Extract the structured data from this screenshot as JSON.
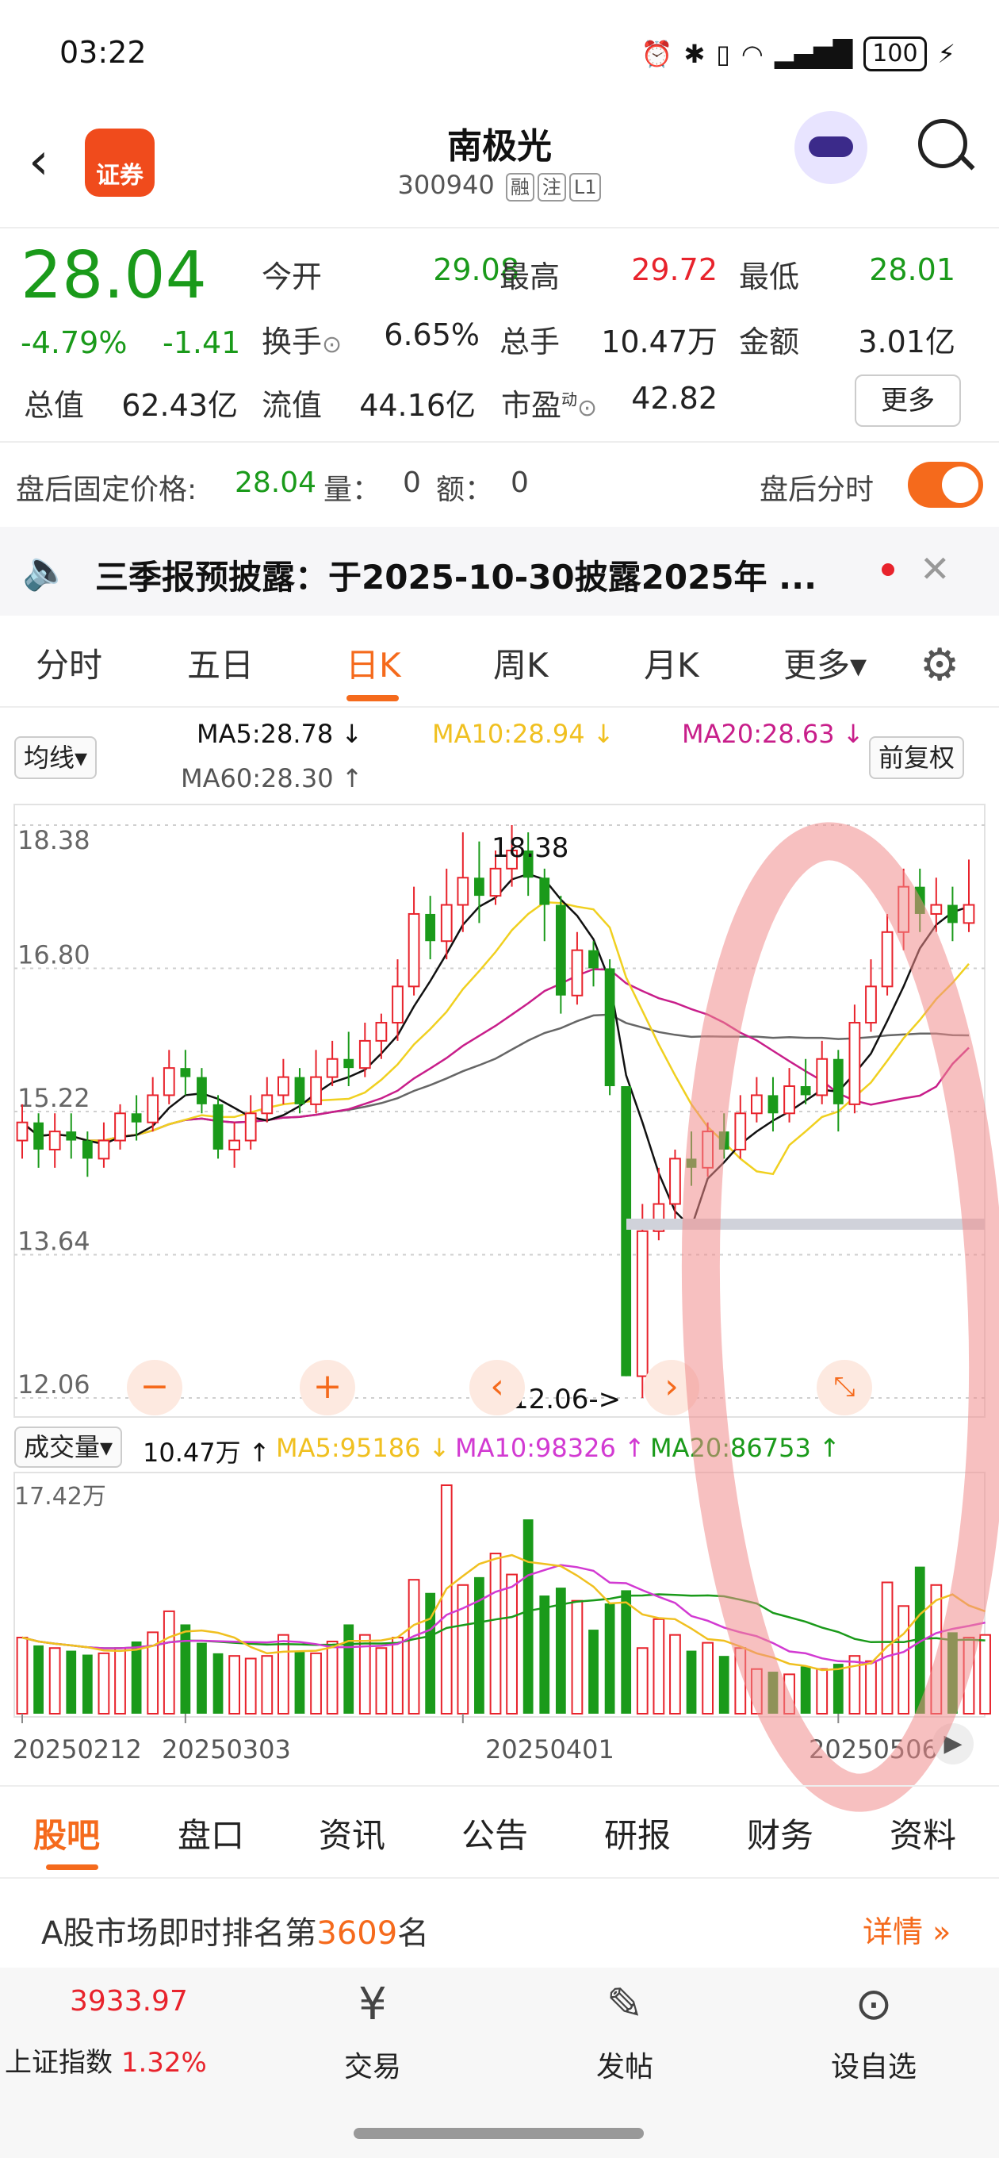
{
  "status_bar": {
    "time": "03:22",
    "battery": "100"
  },
  "header": {
    "stock_name": "南极光",
    "stock_code": "300940",
    "tags": [
      "融",
      "注",
      "L1"
    ],
    "logo_text": "证券"
  },
  "quote": {
    "price": "28.04",
    "change_pct": "-4.79%",
    "change": "-1.41",
    "labels": {
      "open": "今开",
      "high": "最高",
      "low": "最低",
      "turnover": "换手",
      "volume": "总手",
      "amount": "金额",
      "mktcap": "总值",
      "float_cap": "流值",
      "pe": "市盈"
    },
    "values": {
      "open": "29.08",
      "high": "29.72",
      "low": "28.01",
      "turnover": "6.65%",
      "volume": "10.47万",
      "amount": "3.01亿",
      "mktcap": "62.43亿",
      "float_cap": "44.16亿",
      "pe": "42.82"
    },
    "pe_sup": "动",
    "more_button": "更多",
    "colors": {
      "up": "#e8232c",
      "down": "#1a9a1a"
    }
  },
  "after_hours": {
    "label": "盘后固定价格:",
    "price": "28.04",
    "vol_label": "量：",
    "vol": "0",
    "amt_label": "额：",
    "amt": "0",
    "toggle_label": "盘后分时",
    "toggle_on": true
  },
  "notice": {
    "text": "三季报预披露：于2025-10-30披露2025年 ..."
  },
  "chart_tabs": {
    "items": [
      "分时",
      "五日",
      "日K",
      "周K",
      "月K",
      "更多▾"
    ],
    "active": "日K"
  },
  "ma_legend": {
    "selector": "均线▾",
    "ma5": "MA5:28.78 ↓",
    "ma10": "MA10:28.94 ↓",
    "ma20": "MA20:28.63 ↓",
    "ma60": "MA60:28.30 ↑",
    "adjust": "前复权"
  },
  "price_axis": {
    "ticks": [
      "18.38",
      "16.80",
      "15.22",
      "13.64",
      "12.06"
    ],
    "high_marker": "18.38",
    "low_marker": "12.06->"
  },
  "volume_legend": {
    "selector": "成交量▾",
    "vol": "10.47万 ↑",
    "ma5": "MA5:95186 ↓",
    "ma10": "MA10:98326 ↑",
    "ma20": "MA20:86753 ↑",
    "max": "17.42万"
  },
  "date_axis": [
    "20250212",
    "20250303",
    "20250401",
    "20250506"
  ],
  "chart_data": {
    "type": "candlestick",
    "ylim": [
      12.06,
      18.38
    ],
    "volume_max": "17.42万",
    "candles": [
      {
        "o": 14.9,
        "c": 15.1,
        "h": 15.3,
        "l": 14.7
      },
      {
        "o": 15.1,
        "c": 14.8,
        "h": 15.2,
        "l": 14.6
      },
      {
        "o": 14.8,
        "c": 15.0,
        "h": 15.2,
        "l": 14.6
      },
      {
        "o": 15.0,
        "c": 14.9,
        "h": 15.2,
        "l": 14.7
      },
      {
        "o": 14.9,
        "c": 14.7,
        "h": 15.0,
        "l": 14.5
      },
      {
        "o": 14.7,
        "c": 14.9,
        "h": 15.1,
        "l": 14.6
      },
      {
        "o": 14.9,
        "c": 15.2,
        "h": 15.3,
        "l": 14.8
      },
      {
        "o": 15.2,
        "c": 15.1,
        "h": 15.4,
        "l": 14.9
      },
      {
        "o": 15.1,
        "c": 15.4,
        "h": 15.6,
        "l": 15.0
      },
      {
        "o": 15.4,
        "c": 15.7,
        "h": 15.9,
        "l": 15.3
      },
      {
        "o": 15.7,
        "c": 15.6,
        "h": 15.9,
        "l": 15.4
      },
      {
        "o": 15.6,
        "c": 15.3,
        "h": 15.7,
        "l": 15.2
      },
      {
        "o": 15.3,
        "c": 14.8,
        "h": 15.4,
        "l": 14.7
      },
      {
        "o": 14.8,
        "c": 14.9,
        "h": 15.1,
        "l": 14.6
      },
      {
        "o": 14.9,
        "c": 15.2,
        "h": 15.4,
        "l": 14.8
      },
      {
        "o": 15.2,
        "c": 15.4,
        "h": 15.6,
        "l": 15.1
      },
      {
        "o": 15.4,
        "c": 15.6,
        "h": 15.8,
        "l": 15.3
      },
      {
        "o": 15.6,
        "c": 15.3,
        "h": 15.7,
        "l": 15.2
      },
      {
        "o": 15.3,
        "c": 15.6,
        "h": 15.9,
        "l": 15.2
      },
      {
        "o": 15.6,
        "c": 15.8,
        "h": 16.0,
        "l": 15.5
      },
      {
        "o": 15.8,
        "c": 15.7,
        "h": 16.1,
        "l": 15.5
      },
      {
        "o": 15.7,
        "c": 16.0,
        "h": 16.2,
        "l": 15.6
      },
      {
        "o": 16.0,
        "c": 16.2,
        "h": 16.3,
        "l": 15.8
      },
      {
        "o": 16.2,
        "c": 16.6,
        "h": 16.9,
        "l": 16.0
      },
      {
        "o": 16.6,
        "c": 17.4,
        "h": 17.7,
        "l": 16.5
      },
      {
        "o": 17.4,
        "c": 17.1,
        "h": 17.6,
        "l": 16.9
      },
      {
        "o": 17.1,
        "c": 17.5,
        "h": 17.9,
        "l": 16.9
      },
      {
        "o": 17.5,
        "c": 17.8,
        "h": 18.3,
        "l": 17.2
      },
      {
        "o": 17.8,
        "c": 17.6,
        "h": 18.2,
        "l": 17.3
      },
      {
        "o": 17.6,
        "c": 17.9,
        "h": 18.1,
        "l": 17.5
      },
      {
        "o": 17.9,
        "c": 18.1,
        "h": 18.38,
        "l": 17.7
      },
      {
        "o": 18.1,
        "c": 17.8,
        "h": 18.3,
        "l": 17.6
      },
      {
        "o": 17.8,
        "c": 17.5,
        "h": 17.9,
        "l": 17.1
      },
      {
        "o": 17.5,
        "c": 16.5,
        "h": 17.6,
        "l": 16.3
      },
      {
        "o": 16.5,
        "c": 17.0,
        "h": 17.2,
        "l": 16.4
      },
      {
        "o": 17.0,
        "c": 16.8,
        "h": 17.1,
        "l": 16.6
      },
      {
        "o": 16.8,
        "c": 15.5,
        "h": 16.9,
        "l": 15.4
      },
      {
        "o": 15.5,
        "c": 12.3,
        "h": 14.0,
        "l": 12.3
      },
      {
        "o": 12.3,
        "c": 13.9,
        "h": 14.2,
        "l": 12.06
      },
      {
        "o": 13.9,
        "c": 14.2,
        "h": 14.6,
        "l": 13.8
      },
      {
        "o": 14.2,
        "c": 14.7,
        "h": 14.8,
        "l": 14.0
      },
      {
        "o": 14.7,
        "c": 14.6,
        "h": 15.0,
        "l": 14.4
      },
      {
        "o": 14.6,
        "c": 15.0,
        "h": 15.1,
        "l": 14.5
      },
      {
        "o": 15.0,
        "c": 14.8,
        "h": 15.2,
        "l": 14.7
      },
      {
        "o": 14.8,
        "c": 15.2,
        "h": 15.4,
        "l": 14.7
      },
      {
        "o": 15.2,
        "c": 15.4,
        "h": 15.6,
        "l": 15.1
      },
      {
        "o": 15.4,
        "c": 15.2,
        "h": 15.6,
        "l": 15.0
      },
      {
        "o": 15.2,
        "c": 15.5,
        "h": 15.7,
        "l": 15.1
      },
      {
        "o": 15.5,
        "c": 15.4,
        "h": 15.8,
        "l": 15.3
      },
      {
        "o": 15.4,
        "c": 15.8,
        "h": 16.0,
        "l": 15.3
      },
      {
        "o": 15.8,
        "c": 15.3,
        "h": 15.9,
        "l": 15.0
      },
      {
        "o": 15.3,
        "c": 16.2,
        "h": 16.4,
        "l": 15.2
      },
      {
        "o": 16.2,
        "c": 16.6,
        "h": 16.9,
        "l": 16.1
      },
      {
        "o": 16.6,
        "c": 17.2,
        "h": 17.4,
        "l": 16.5
      },
      {
        "o": 17.2,
        "c": 17.7,
        "h": 17.9,
        "l": 17.0
      },
      {
        "o": 17.7,
        "c": 17.4,
        "h": 17.9,
        "l": 17.2
      },
      {
        "o": 17.4,
        "c": 17.5,
        "h": 17.8,
        "l": 17.2
      },
      {
        "o": 17.5,
        "c": 17.3,
        "h": 17.7,
        "l": 17.1
      },
      {
        "o": 17.3,
        "c": 17.5,
        "h": 18.0,
        "l": 17.2
      }
    ],
    "volumes": [
      5.8,
      5.2,
      5.0,
      4.8,
      4.5,
      4.6,
      5.0,
      5.5,
      6.2,
      7.8,
      6.8,
      5.4,
      4.6,
      4.4,
      4.2,
      4.4,
      6.0,
      4.8,
      4.6,
      5.5,
      6.8,
      6.0,
      5.0,
      5.8,
      10.2,
      9.2,
      17.4,
      9.8,
      10.4,
      12.2,
      10.6,
      14.8,
      9.0,
      9.6,
      8.6,
      6.4,
      8.4,
      9.4,
      5.0,
      7.2,
      6.0,
      4.8,
      5.4,
      4.4,
      5.0,
      3.4,
      3.2,
      3.0,
      3.6,
      3.4,
      3.8,
      4.4,
      4.0,
      10.0,
      8.2,
      11.2,
      9.8,
      6.2,
      5.8,
      6.0
    ]
  },
  "bottom_tabs": {
    "items": [
      "股吧",
      "盘口",
      "资讯",
      "公告",
      "研报",
      "财务",
      "资料"
    ],
    "active": "股吧"
  },
  "rank": {
    "prefix": "A股市场即时排名第",
    "num": "3609",
    "suffix": "名",
    "detail": "详情 »"
  },
  "bottom_nav": {
    "index_value": "3933.97",
    "index_name": "上证指数",
    "index_pct": "1.32%",
    "trade": "交易",
    "post": "发帖",
    "watch": "设自选"
  }
}
